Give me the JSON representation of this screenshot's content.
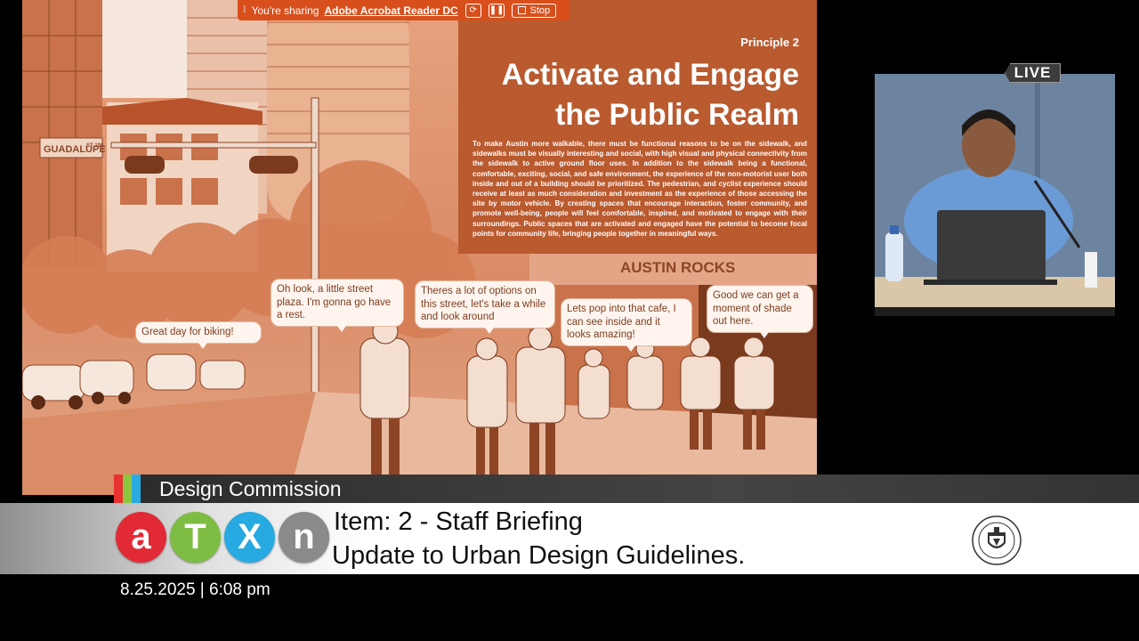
{
  "share_bar": {
    "prefix": "You're sharing",
    "app_name": "Adobe Acrobat Reader DC",
    "stop_label": "Stop",
    "color": "#d84f1c"
  },
  "slide": {
    "principle": "Principle 2",
    "title": "Activate and Engage the Public Realm",
    "body": "To make Austin more walkable, there must be functional reasons to be on the sidewalk, and sidewalks must be visually interesting and social, with high visual and physical connectivity from the sidewalk to active ground floor uses. In addition to the sidewalk being a functional, comfortable, exciting, social, and safe environment, the experience of the non-motorist user both inside and out of a building should be prioritized. The pedestrian, and cyclist experience should receive at least as much consideration and investment as the experience of those accessing the site by motor vehicle. By creating spaces that encourage interaction, foster community, and promote well-being, people will feel comfortable, inspired, and motivated to engage with their surroundings. Public spaces that are activated and engaged have the potential to become focal points for community life, bringing people together in meaningful ways.",
    "street_sign": "GUADALUPE",
    "street_sign_block": "ST 100",
    "storefront_sign": "AUSTIN ROCKS",
    "bubbles": [
      "Great day for biking!",
      "Oh look, a little street plaza. I'm gonna go have a rest.",
      "Theres a lot of options on this street, let's take a while and look around",
      "Lets pop into that cafe, I can see inside and it looks amazing!",
      "Good we can get a moment of shade out here."
    ]
  },
  "camera": {
    "live_label": "LIVE"
  },
  "lower_third": {
    "department": "Design Commission",
    "stripe_colors": [
      "#e8322f",
      "#8cc63f",
      "#29abe2"
    ],
    "logo_letters": [
      {
        "letter": "a",
        "color": "#e12a36"
      },
      {
        "letter": "T",
        "color": "#7dbd43"
      },
      {
        "letter": "X",
        "color": "#27a9e1"
      },
      {
        "letter": "n",
        "color": "#8a8a8a"
      }
    ],
    "item_line1": "Item: 2 - Staff Briefing",
    "item_line2": "Update to Urban Design Guidelines.",
    "seal_icon": "city-of-austin-seal-icon"
  },
  "timestamp": "8.25.2025 | 6:08 pm"
}
